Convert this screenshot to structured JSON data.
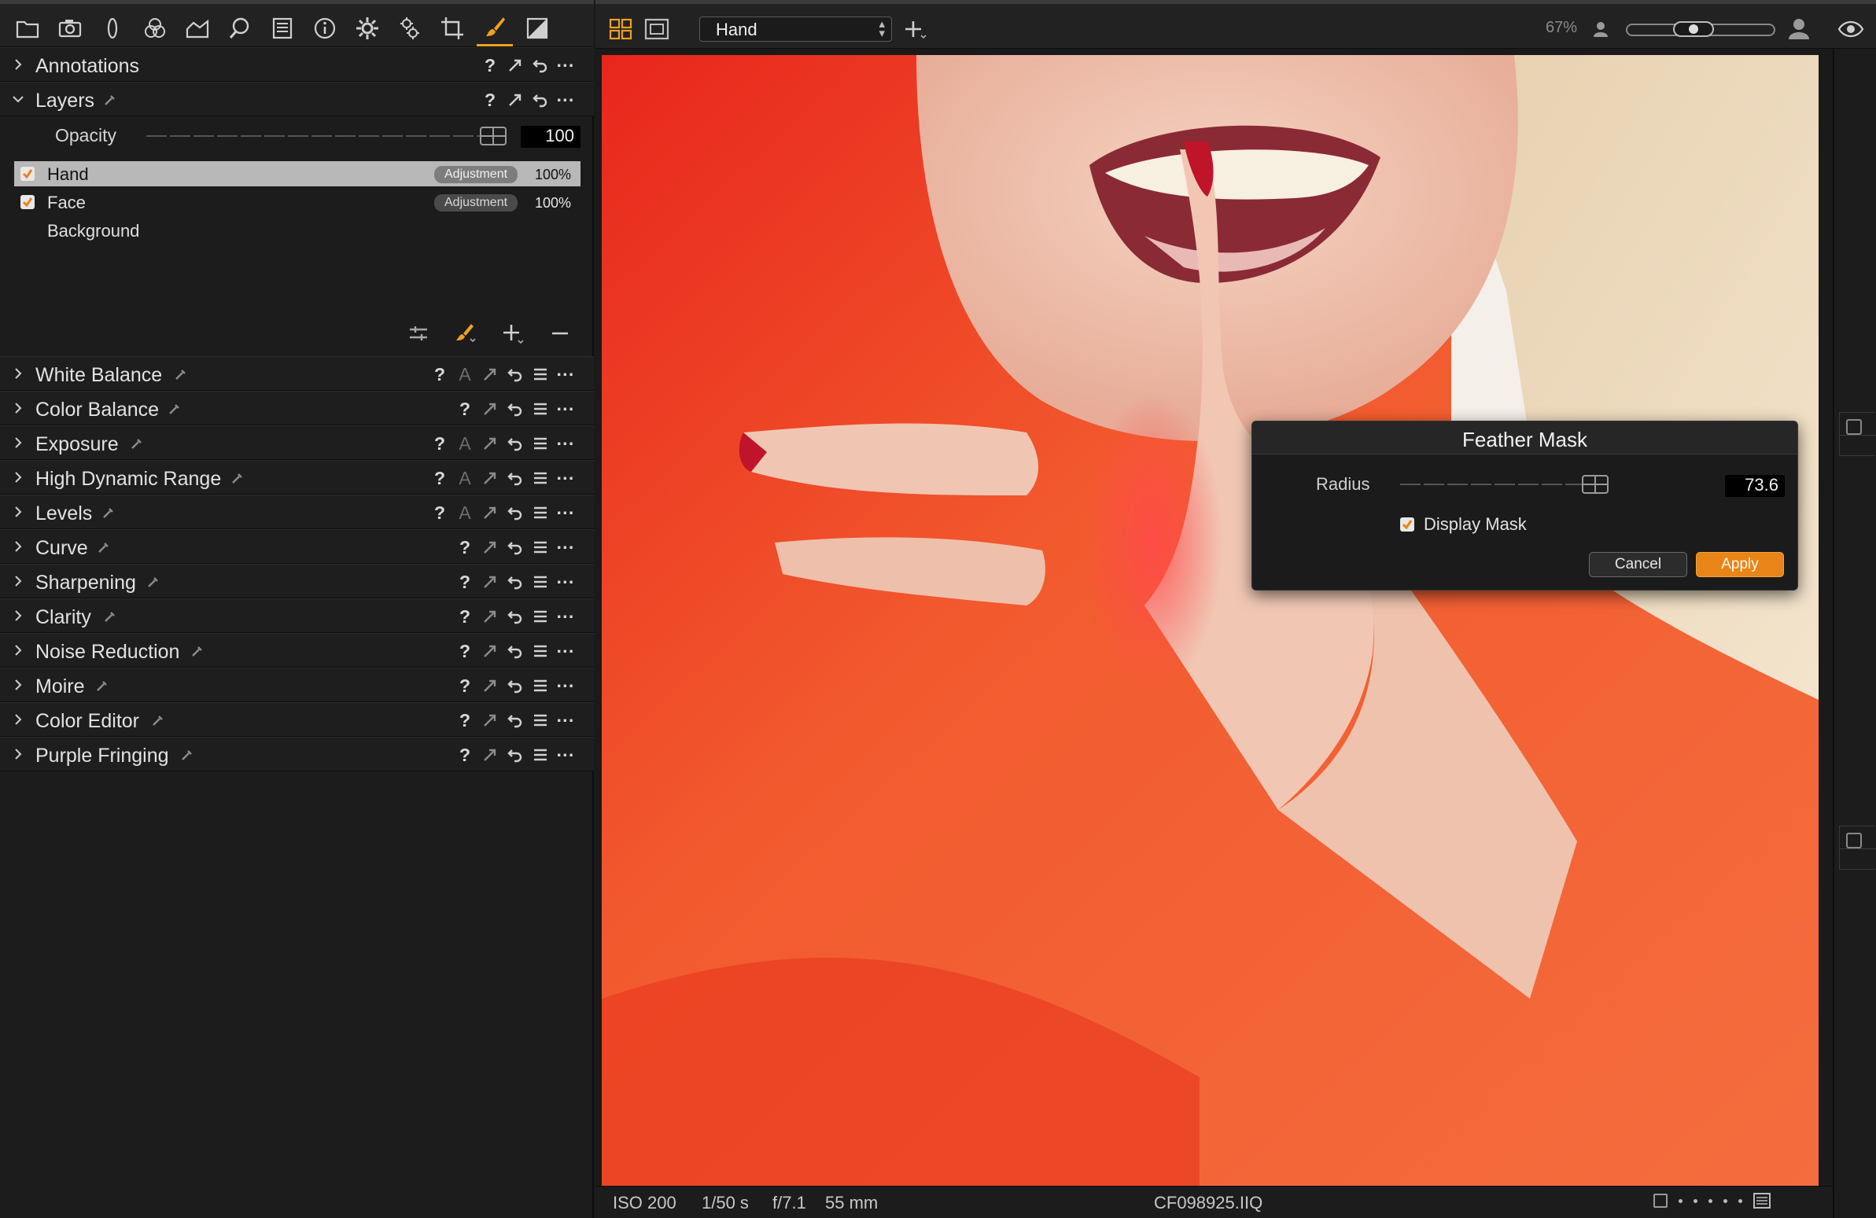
{
  "tool_tabs": [
    {
      "name": "library-icon"
    },
    {
      "name": "capture-icon"
    },
    {
      "name": "lens-icon"
    },
    {
      "name": "color-icon"
    },
    {
      "name": "exposure-icon"
    },
    {
      "name": "details-icon"
    },
    {
      "name": "metadata-icon"
    },
    {
      "name": "info-icon"
    },
    {
      "name": "settings-icon"
    },
    {
      "name": "adjustments-icon"
    },
    {
      "name": "crop-icon"
    },
    {
      "name": "local-adjustments-icon"
    },
    {
      "name": "output-icon"
    }
  ],
  "annotations": {
    "title": "Annotations"
  },
  "layers": {
    "title": "Layers",
    "opacity_label": "Opacity",
    "opacity_value": "100",
    "items": [
      {
        "name": "Hand",
        "badge": "Adjustment",
        "percent": "100%",
        "checked": true
      },
      {
        "name": "Face",
        "badge": "Adjustment",
        "percent": "100%",
        "checked": true
      },
      {
        "name": "Background"
      }
    ]
  },
  "tools": [
    {
      "title": "White Balance",
      "auto": true
    },
    {
      "title": "Color Balance",
      "auto": false
    },
    {
      "title": "Exposure",
      "auto": true
    },
    {
      "title": "High Dynamic Range",
      "auto": true
    },
    {
      "title": "Levels",
      "auto": true
    },
    {
      "title": "Curve",
      "auto": false
    },
    {
      "title": "Sharpening",
      "auto": false
    },
    {
      "title": "Clarity",
      "auto": false
    },
    {
      "title": "Noise Reduction",
      "auto": false
    },
    {
      "title": "Moire",
      "auto": false
    },
    {
      "title": "Color Editor",
      "auto": false
    },
    {
      "title": "Purple Fringing",
      "auto": false
    }
  ],
  "section_icons": {
    "help": "?",
    "auto": "A"
  },
  "viewer": {
    "layer_select": "Hand",
    "zoom": "67%",
    "zoom_level": 0.43
  },
  "status_bar": {
    "iso": "ISO 200",
    "shutter": "1/50 s",
    "aperture": "f/7.1",
    "focal_length": "55 mm",
    "filename": "CF098925.IIQ"
  },
  "feather_dialog": {
    "title": "Feather Mask",
    "radius_label": "Radius",
    "radius_value": "73.6",
    "display_mask_label": "Display Mask",
    "display_mask_checked": true,
    "cancel_label": "Cancel",
    "apply_label": "Apply"
  },
  "colors": {
    "accent": "#f0a020",
    "apply": "#e88418",
    "mask": "#ff4a4a"
  }
}
